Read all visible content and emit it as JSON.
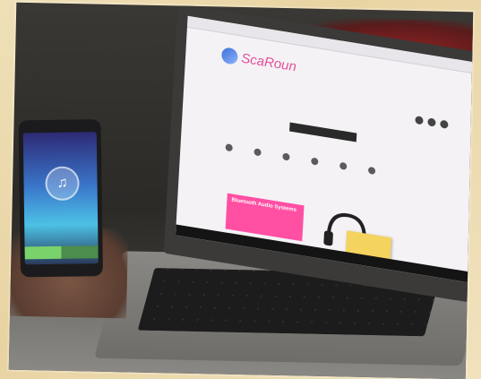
{
  "scene": {
    "website": {
      "logo_text": "ScaRoun",
      "banner_text": "Bluetooth Audio Systems"
    },
    "icons": {
      "logo": "globe-logo-icon",
      "music": "music-note-icon",
      "headphones": "headphones-icon"
    },
    "colors": {
      "accent_pink": "#ff4fa3",
      "phone_screen_blue": "#3a74c9",
      "call_green": "#7ad36a"
    }
  }
}
